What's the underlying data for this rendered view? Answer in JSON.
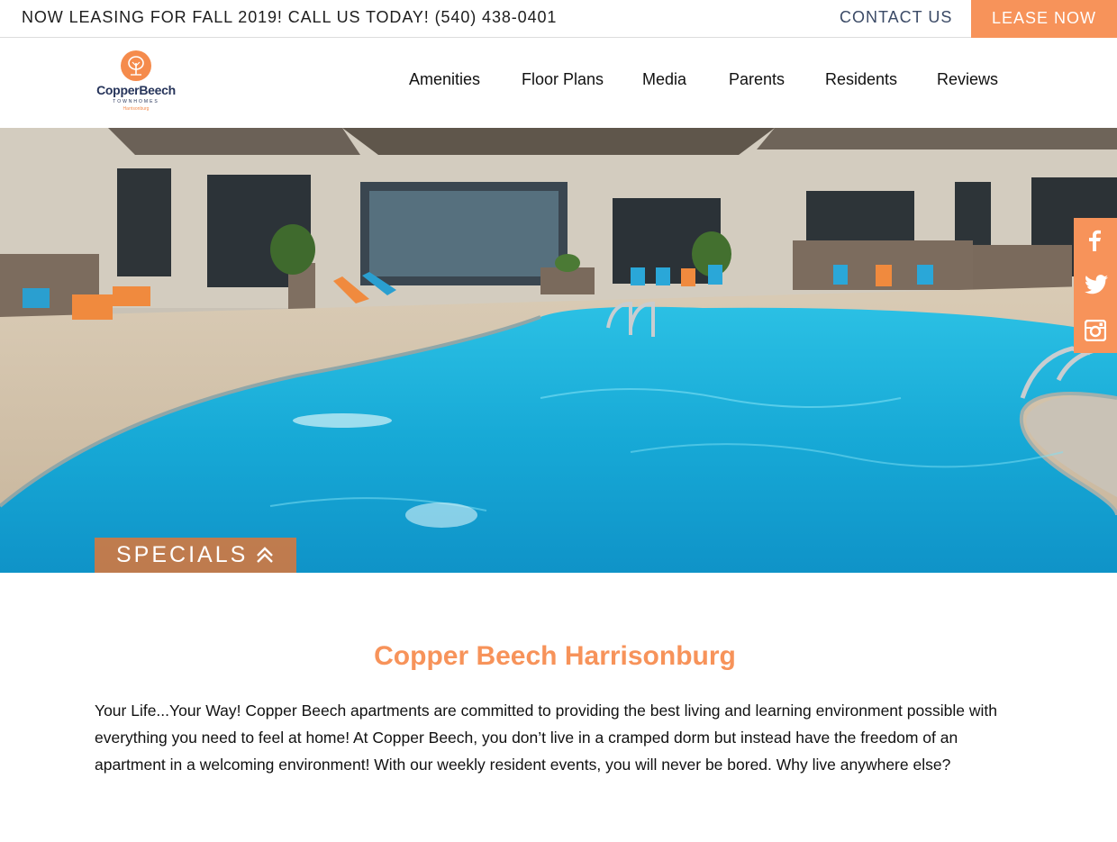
{
  "topbar": {
    "announcement": "NOW LEASING FOR FALL 2019! CALL US TODAY! (540) 438-0401",
    "contact_label": "CONTACT US",
    "lease_label": "LEASE NOW"
  },
  "logo": {
    "brand": "CopperBeech",
    "sub": "TOWNHOMES",
    "city": "Harrisonburg"
  },
  "nav": {
    "items": [
      {
        "label": "Amenities"
      },
      {
        "label": "Floor Plans"
      },
      {
        "label": "Media"
      },
      {
        "label": "Parents"
      },
      {
        "label": "Residents"
      },
      {
        "label": "Reviews"
      }
    ]
  },
  "hero": {
    "specials_label": "SPECIALS",
    "specials_icon": "double-chevron-up-icon"
  },
  "social": {
    "items": [
      {
        "icon": "facebook-icon"
      },
      {
        "icon": "twitter-icon"
      },
      {
        "icon": "instagram-icon"
      }
    ]
  },
  "content": {
    "title": "Copper Beech Harrisonburg",
    "paragraph": "Your Life...Your Way! Copper Beech apartments are committed to providing the best living and learning environment possible with everything you need to feel at home! At Copper Beech, you don’t live in a cramped dorm but instead have the freedom of an apartment in a welcoming environment! With our weekly resident events, you will never be bored. Why live anywhere else?"
  },
  "colors": {
    "accent": "#f7935a",
    "navy": "#26345a",
    "pool": "#1fb3d6"
  }
}
